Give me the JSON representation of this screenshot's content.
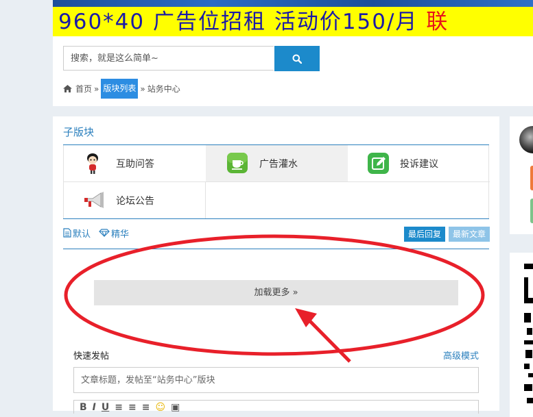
{
  "ad": {
    "text_main": "960*40 广告位招租 活动价150/月 ",
    "text_red": "联"
  },
  "search": {
    "placeholder": "搜索，就是这么简单~"
  },
  "breadcrumb": {
    "home": "首页",
    "sep": "»",
    "current": "版块列表",
    "forum": "站务中心"
  },
  "subforums": {
    "title": "子版块",
    "items": [
      {
        "label": "互助问答",
        "icon": "cartoon-mascot-icon"
      },
      {
        "label": "广告灌水",
        "icon": "teacup-icon"
      },
      {
        "label": "投诉建议",
        "icon": "edit-icon"
      },
      {
        "label": "论坛公告",
        "icon": "megaphone-icon"
      }
    ]
  },
  "filters": {
    "default": "默认",
    "digest": "精华",
    "sort_last_reply": "最后回复",
    "sort_newest": "最新文章"
  },
  "load_more": "加载更多 »",
  "quick_post": {
    "title": "快速发帖",
    "advanced": "高级模式",
    "title_placeholder": "文章标题，发帖至“站务中心”版块"
  },
  "colors": {
    "accent": "#1c8acb",
    "ad_background": "#ffff00",
    "ad_text": "#1a1aa8",
    "annotation_red": "#e8202a"
  }
}
